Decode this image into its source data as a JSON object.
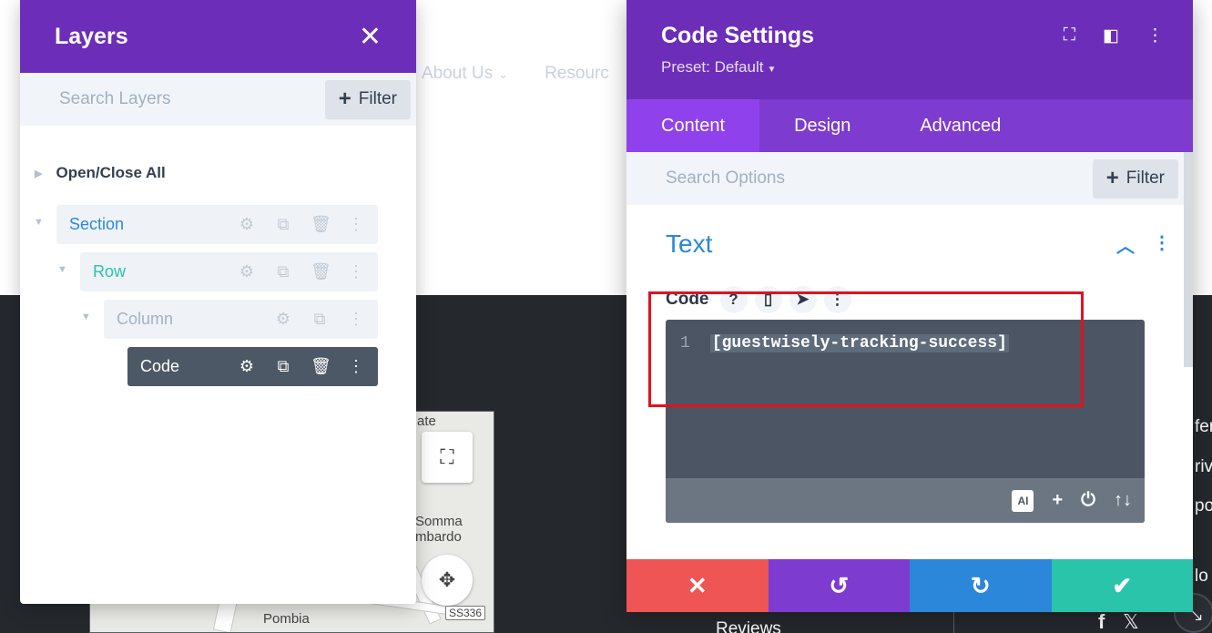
{
  "background": {
    "nav_items": [
      {
        "label": "About Us"
      },
      {
        "label": "Resourc"
      }
    ],
    "map_labels": [
      "ate",
      "Somma",
      "mbardo",
      "Pombia"
    ],
    "map_badge": "SS336",
    "right_text": [
      "fer",
      "riv",
      "po",
      "lo"
    ],
    "footer_link": "Reviews",
    "social": [
      "f",
      "𝕏"
    ]
  },
  "layers_panel": {
    "title": "Layers",
    "search_placeholder": "Search Layers",
    "filter_label": "Filter",
    "open_close_all": "Open/Close All",
    "items": [
      {
        "label": "Section",
        "color": "#2b87da"
      },
      {
        "label": "Row",
        "color": "#29c4a9"
      },
      {
        "label": "Column",
        "color": "#a5b1c0"
      },
      {
        "label": "Code",
        "color": "#ffffff"
      }
    ]
  },
  "settings": {
    "title": "Code Settings",
    "preset": "Preset: Default",
    "tabs": [
      {
        "label": "Content",
        "active": true
      },
      {
        "label": "Design",
        "active": false
      },
      {
        "label": "Advanced",
        "active": false
      }
    ],
    "search_placeholder": "Search Options",
    "filter_label": "Filter",
    "group_title": "Text",
    "field_label": "Code",
    "editor": {
      "line_number": "1",
      "code": "[guestwisely-tracking-success]",
      "ai_label": "AI"
    }
  },
  "colors": {
    "purple": "#6c2eb9",
    "tab_active": "#8f42ec",
    "blue": "#2b87da",
    "teal": "#29c4a9",
    "red": "#ef5555",
    "highlight": "#e4101f"
  }
}
